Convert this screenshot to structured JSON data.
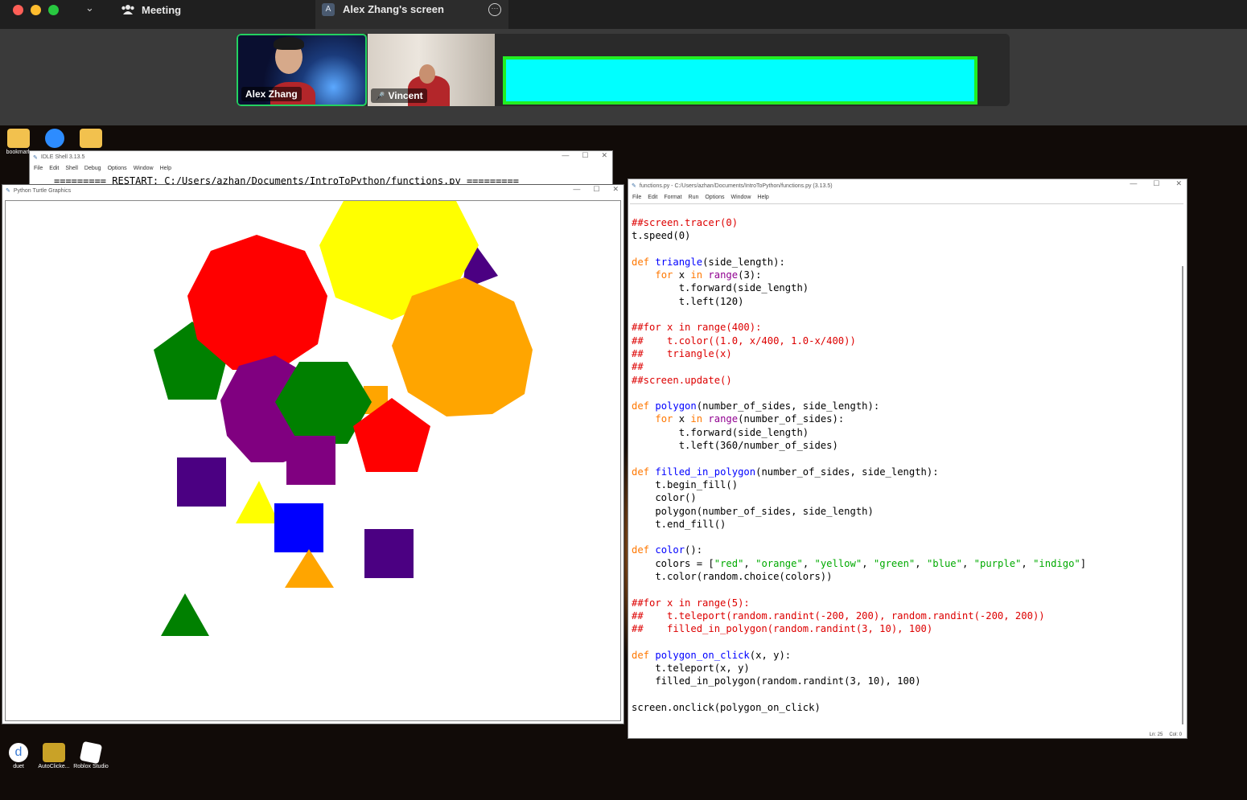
{
  "zoom": {
    "meeting_label": "Meeting",
    "screen_badge": "A",
    "screen_label": "Alex Zhang's screen",
    "participants": [
      {
        "name": "Alex Zhang"
      },
      {
        "name": "Vincent"
      }
    ]
  },
  "desktop": {
    "icons_top": [
      {
        "label": "bookmark"
      },
      {
        "label": "zoom"
      },
      {
        "label": ""
      }
    ],
    "icons_bottom": [
      {
        "label": "duet"
      },
      {
        "label": "AutoClicke..."
      },
      {
        "label": "Roblox Studio"
      }
    ]
  },
  "idle_shell": {
    "title": "IDLE Shell 3.13.5",
    "menu": [
      "File",
      "Edit",
      "Shell",
      "Debug",
      "Options",
      "Window",
      "Help"
    ],
    "restart_line": "========= RESTART: C:/Users/azhan/Documents/IntroToPython/functions.py ========="
  },
  "turtle": {
    "title": "Python Turtle Graphics"
  },
  "editor": {
    "title": "functions.py - C:/Users/azhan/Documents/IntroToPython/functions.py (3.13.5)",
    "menu": [
      "File",
      "Edit",
      "Format",
      "Run",
      "Options",
      "Window",
      "Help"
    ],
    "status_ln": "Ln: 25",
    "status_col": "Col: 0",
    "code_lines": [
      "##screen.tracer(0)",
      "t.speed(0)",
      "",
      "def triangle(side_length):",
      "    for x in range(3):",
      "        t.forward(side_length)",
      "        t.left(120)",
      "",
      "##for x in range(400):",
      "##    t.color((1.0, x/400, 1.0-x/400))",
      "##    triangle(x)",
      "##",
      "##screen.update()",
      "",
      "def polygon(number_of_sides, side_length):",
      "    for x in range(number_of_sides):",
      "        t.forward(side_length)",
      "        t.left(360/number_of_sides)",
      "",
      "def filled_in_polygon(number_of_sides, side_length):",
      "    t.begin_fill()",
      "    color()",
      "    polygon(number_of_sides, side_length)",
      "    t.end_fill()",
      "",
      "def color():",
      "    colors = [\"red\", \"orange\", \"yellow\", \"green\", \"blue\", \"purple\", \"indigo\"]",
      "    t.color(random.choice(colors))",
      "",
      "##for x in range(5):",
      "##    t.teleport(random.randint(-200, 200), random.randint(-200, 200))",
      "##    filled_in_polygon(random.randint(3, 10), 100)",
      "",
      "def polygon_on_click(x, y):",
      "    t.teleport(x, y)",
      "    filled_in_polygon(random.randint(3, 10), 100)",
      "",
      "screen.onclick(polygon_on_click)"
    ]
  },
  "colors": {
    "red": "#ff0000",
    "orange": "#ffa500",
    "yellow": "#ffff00",
    "green": "#008000",
    "blue": "#0000ff",
    "purple": "#800080",
    "indigo": "#4b0082"
  }
}
